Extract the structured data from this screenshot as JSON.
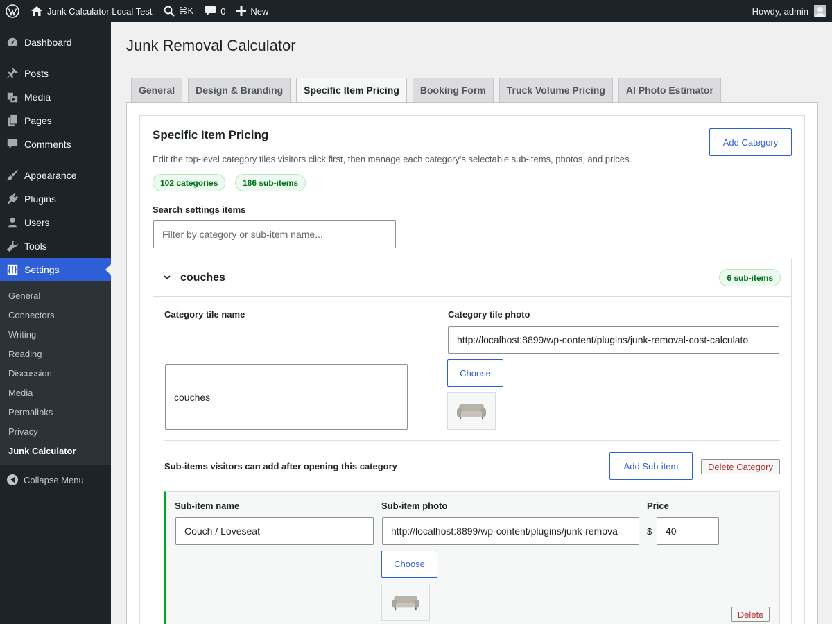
{
  "adminbar": {
    "site_name": "Junk Calculator Local Test",
    "search_shortcut": "⌘K",
    "comments_count": "0",
    "new_label": "New",
    "howdy": "Howdy, admin"
  },
  "sidebar": {
    "items": [
      {
        "label": "Dashboard",
        "icon": "dashboard-icon"
      },
      {
        "label": "Posts",
        "icon": "pin-icon"
      },
      {
        "label": "Media",
        "icon": "media-icon"
      },
      {
        "label": "Pages",
        "icon": "pages-icon"
      },
      {
        "label": "Comments",
        "icon": "comment-icon"
      },
      {
        "label": "Appearance",
        "icon": "brush-icon"
      },
      {
        "label": "Plugins",
        "icon": "plugin-icon"
      },
      {
        "label": "Users",
        "icon": "user-icon"
      },
      {
        "label": "Tools",
        "icon": "wrench-icon"
      },
      {
        "label": "Settings",
        "icon": "settings-icon"
      }
    ],
    "submenu": [
      "General",
      "Connectors",
      "Writing",
      "Reading",
      "Discussion",
      "Media",
      "Permalinks",
      "Privacy",
      "Junk Calculator"
    ],
    "collapse": "Collapse Menu"
  },
  "page": {
    "title": "Junk Removal Calculator",
    "tabs": [
      "General",
      "Design & Branding",
      "Specific Item Pricing",
      "Booking Form",
      "Truck Volume Pricing",
      "AI Photo Estimator"
    ],
    "active_tab": "Specific Item Pricing"
  },
  "section": {
    "title": "Specific Item Pricing",
    "description": "Edit the top-level category tiles visitors click first, then manage each category's selectable sub-items, photos, and prices.",
    "add_category": "Add Category",
    "categories_count": "102 categories",
    "subitems_count": "186 sub-items",
    "search_label": "Search settings items",
    "search_placeholder": "Filter by category or sub-item name..."
  },
  "category": {
    "name": "couches",
    "subitems_badge": "6 sub-items",
    "tile_name_label": "Category tile name",
    "tile_name_value": "couches",
    "tile_photo_label": "Category tile photo",
    "tile_photo_url": "http://localhost:8899/wp-content/plugins/junk-removal-cost-calculato",
    "choose": "Choose",
    "subitems_heading": "Sub-items visitors can add after opening this category",
    "add_subitem": "Add Sub-item",
    "delete_category": "Delete Category"
  },
  "subitem": {
    "name_label": "Sub-item name",
    "name_value": "Couch / Loveseat",
    "photo_label": "Sub-item photo",
    "photo_url": "http://localhost:8899/wp-content/plugins/junk-remova",
    "price_label": "Price",
    "currency": "$",
    "price_value": "40",
    "choose": "Choose",
    "delete": "Delete"
  },
  "colors": {
    "accent": "#2f5fd6",
    "sidebar_bg": "#1d2327",
    "success": "#00a32a",
    "danger": "#b32d2e"
  }
}
